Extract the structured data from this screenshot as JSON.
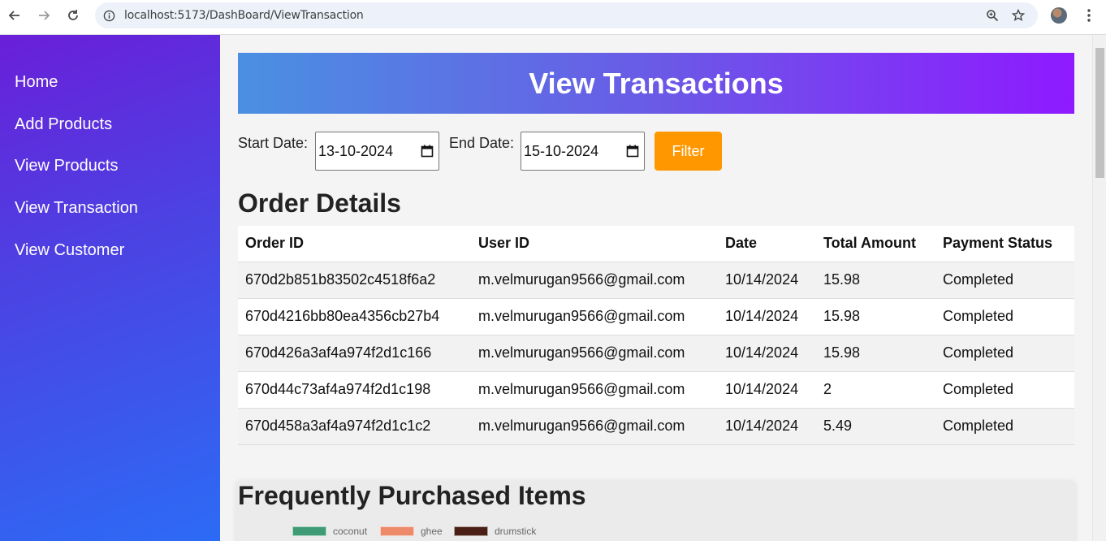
{
  "browser": {
    "url": "localhost:5173/DashBoard/ViewTransaction"
  },
  "sidebar": {
    "items": [
      {
        "label": "Home"
      },
      {
        "label": "Add Products"
      },
      {
        "label": "View Products"
      },
      {
        "label": "View Transaction"
      },
      {
        "label": "View Customer"
      }
    ]
  },
  "page": {
    "title": "View Transactions"
  },
  "filter": {
    "start_label": "Start Date:",
    "start_value": "13-10-2024",
    "end_label": "End Date:",
    "end_value": "15-10-2024",
    "button_label": "Filter"
  },
  "orders": {
    "title": "Order Details",
    "columns": [
      "Order ID",
      "User ID",
      "Date",
      "Total Amount",
      "Payment Status"
    ],
    "rows": [
      [
        "670d2b851b83502c4518f6a2",
        "m.velmurugan9566@gmail.com",
        "10/14/2024",
        "15.98",
        "Completed"
      ],
      [
        "670d4216bb80ea4356cb27b4",
        "m.velmurugan9566@gmail.com",
        "10/14/2024",
        "15.98",
        "Completed"
      ],
      [
        "670d426a3af4a974f2d1c166",
        "m.velmurugan9566@gmail.com",
        "10/14/2024",
        "15.98",
        "Completed"
      ],
      [
        "670d44c73af4a974f2d1c198",
        "m.velmurugan9566@gmail.com",
        "10/14/2024",
        "2",
        "Completed"
      ],
      [
        "670d458a3af4a974f2d1c1c2",
        "m.velmurugan9566@gmail.com",
        "10/14/2024",
        "5.49",
        "Completed"
      ]
    ]
  },
  "frequent": {
    "title": "Frequently Purchased Items",
    "legend": [
      {
        "label": "coconut",
        "color": "#3e9b74"
      },
      {
        "label": "ghee",
        "color": "#ec8a6a"
      },
      {
        "label": "drumstick",
        "color": "#4a1f15"
      }
    ]
  },
  "colors": {
    "filter_button": "#ff9800",
    "banner_start": "#4a90e2",
    "banner_end": "#8e1aff"
  }
}
